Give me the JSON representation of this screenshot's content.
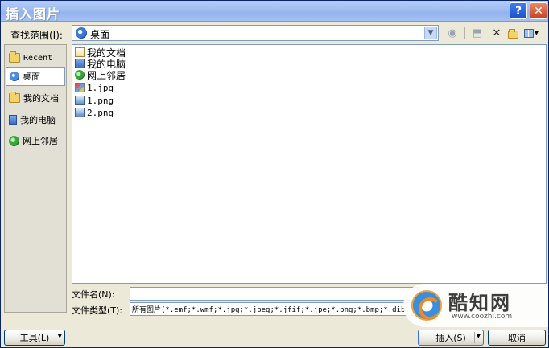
{
  "window": {
    "title": "插入图片"
  },
  "lookin": {
    "label": "查找范围(I):",
    "value": "桌面"
  },
  "places": [
    {
      "label": "Recent",
      "icon": "folder-icon"
    },
    {
      "label": "桌面",
      "icon": "desktop-icon",
      "active": true
    },
    {
      "label": "我的文档",
      "icon": "documents-icon"
    },
    {
      "label": "我的电脑",
      "icon": "computer-icon"
    },
    {
      "label": "网上邻居",
      "icon": "network-icon"
    }
  ],
  "files": [
    {
      "name": "我的文档",
      "icon": "documents-icon"
    },
    {
      "name": "我的电脑",
      "icon": "computer-icon"
    },
    {
      "name": "网上邻居",
      "icon": "network-icon"
    },
    {
      "name": "1.jpg",
      "icon": "jpg-file-icon"
    },
    {
      "name": "1.png",
      "icon": "png-file-icon"
    },
    {
      "name": "2.png",
      "icon": "png-file-icon"
    }
  ],
  "filename": {
    "label": "文件名(N):",
    "value": ""
  },
  "filetype": {
    "label": "文件类型(T):",
    "value": "所有图片(*.emf;*.wmf;*.jpg;*.jpeg;*.jfif;*.jpe;*.png;*.bmp;*.dib;*"
  },
  "buttons": {
    "tools": "工具(L)",
    "insert": "插入(S)",
    "cancel": "取消"
  },
  "watermark": {
    "title": "酷知网",
    "url": "www.coozhi.com"
  }
}
